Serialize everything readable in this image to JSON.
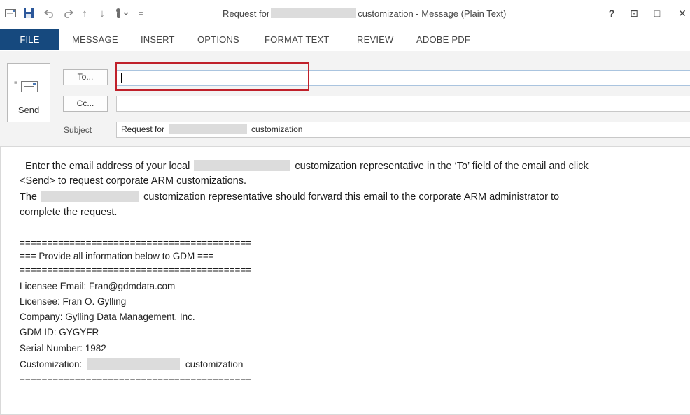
{
  "title_bar": {
    "title_prefix": "Request for",
    "title_suffix": "customization - Message (Plain Text)",
    "quick_access": [
      "mail-icon",
      "save-icon",
      "undo-icon",
      "redo-icon",
      "up-arrow-icon",
      "down-arrow-icon",
      "touch-mode-icon",
      "customize-qat-icon"
    ],
    "window_buttons": {
      "help": "?",
      "ribbon_options": "⊡",
      "maximize": "□",
      "close": "✕"
    }
  },
  "ribbon": {
    "tabs": [
      "FILE",
      "MESSAGE",
      "INSERT",
      "OPTIONS",
      "FORMAT TEXT",
      "REVIEW",
      "ADOBE PDF"
    ]
  },
  "compose": {
    "send_label": "Send",
    "to_button": "To...",
    "cc_button": "Cc...",
    "to_value": "",
    "cc_value": "",
    "subject_label": "Subject",
    "subject_prefix": "Request for",
    "subject_suffix": "customization"
  },
  "message_body": {
    "line1_a": "Enter the email address of your local",
    "line1_b": "customization representative in the ‘To’ field of the email and click",
    "line2": "<Send> to request corporate ARM customizations.",
    "line3_a": "The",
    "line3_b": "customization representative should forward this email to the corporate ARM administrator to",
    "line4": "complete the request.",
    "rule1": "==========================================",
    "section_header": "=== Provide all information below to GDM ===",
    "rule2": "==========================================",
    "licensee_email": "Licensee Email: Fran@gdmdata.com",
    "licensee": "Licensee: Fran O. Gylling",
    "company": "Company: Gylling Data Management, Inc.",
    "gdm_id": "GDM ID: GYGYFR",
    "serial_number": "Serial Number: 1982",
    "customization_label": "Customization:",
    "customization_suffix": "customization",
    "rule3": "=========================================="
  }
}
